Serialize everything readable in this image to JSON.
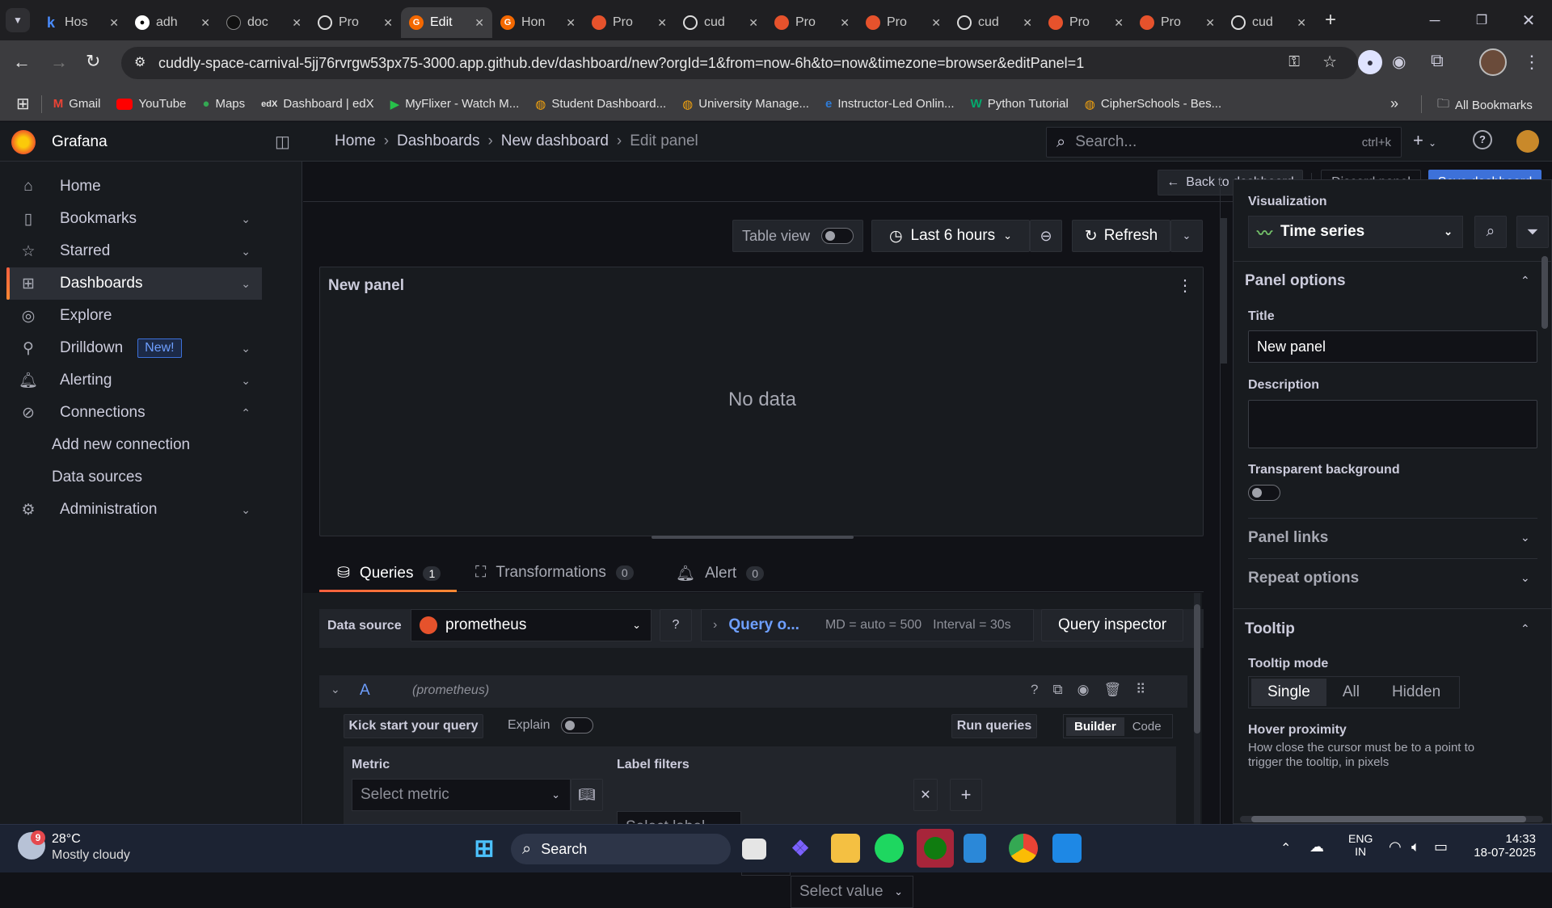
{
  "browser": {
    "tabs": [
      {
        "title": "Hos",
        "icon": "k"
      },
      {
        "title": "adh",
        "icon": "github"
      },
      {
        "title": "doc",
        "icon": "github"
      },
      {
        "title": "Pro",
        "icon": "globe"
      },
      {
        "title": "Edit",
        "icon": "grafana"
      },
      {
        "title": "Hon",
        "icon": "grafana"
      },
      {
        "title": "Pro",
        "icon": "prometheus"
      },
      {
        "title": "cud",
        "icon": "globe"
      },
      {
        "title": "Pro",
        "icon": "prometheus"
      },
      {
        "title": "Pro",
        "icon": "prometheus"
      },
      {
        "title": "cud",
        "icon": "globe"
      },
      {
        "title": "Pro",
        "icon": "prometheus"
      },
      {
        "title": "Pro",
        "icon": "prometheus"
      },
      {
        "title": "cud",
        "icon": "globe"
      }
    ],
    "url": "cuddly-space-carnival-5jj76rvrgw53px75-3000.app.github.dev/dashboard/new?orgId=1&from=now-6h&to=now&timezone=browser&editPanel=1",
    "bookmarks": [
      "Gmail",
      "YouTube",
      "Maps",
      "Dashboard | edX",
      "MyFlixer - Watch M...",
      "Student Dashboard...",
      "University Manage...",
      "Instructor-Led Onlin...",
      "Python Tutorial",
      "CipherSchools - Bes..."
    ],
    "all_bookmarks": "All Bookmarks"
  },
  "grafana": {
    "app_name": "Grafana",
    "breadcrumb": [
      "Home",
      "Dashboards",
      "New dashboard",
      "Edit panel"
    ],
    "search_placeholder": "Search...",
    "search_shortcut": "ctrl+k",
    "nav": [
      {
        "label": "Home",
        "icon": "home-icon"
      },
      {
        "label": "Bookmarks",
        "icon": "bookmark-icon"
      },
      {
        "label": "Starred",
        "icon": "star-icon"
      },
      {
        "label": "Dashboards",
        "icon": "apps-icon"
      },
      {
        "label": "Explore",
        "icon": "compass-icon"
      },
      {
        "label": "Drilldown",
        "icon": "drilldown-icon",
        "badge": "New!"
      },
      {
        "label": "Alerting",
        "icon": "bell-icon"
      },
      {
        "label": "Connections",
        "icon": "connections-icon"
      },
      {
        "label": "Add new connection"
      },
      {
        "label": "Data sources"
      },
      {
        "label": "Administration",
        "icon": "cog-icon"
      }
    ],
    "actions": {
      "back": "Back to dashboard",
      "discard": "Discard panel",
      "save": "Save dashboard"
    },
    "panel_toolbar": {
      "table_view": "Table view",
      "time_range": "Last 6 hours",
      "refresh": "Refresh"
    },
    "panel": {
      "title": "New panel",
      "empty": "No data"
    },
    "tabs": [
      {
        "label": "Queries",
        "count": "1"
      },
      {
        "label": "Transformations",
        "count": "0"
      },
      {
        "label": "Alert",
        "count": "0"
      }
    ],
    "query": {
      "datasource_label": "Data source",
      "datasource": "prometheus",
      "query_options": "Query o...",
      "md": "MD = auto = 500",
      "interval": "Interval = 30s",
      "inspector": "Query inspector",
      "ref_id": "A",
      "ref_ds": "(prometheus)",
      "kick_start": "Kick start your query",
      "explain": "Explain",
      "run": "Run queries",
      "builder": "Builder",
      "code": "Code",
      "metric_label": "Metric",
      "metric_placeholder": "Select metric",
      "label_filters": "Label filters",
      "select_label": "Select label",
      "operator": "=",
      "select_value": "Select value"
    },
    "options": {
      "visualization_label": "Visualization",
      "visualization": "Time series",
      "panel_options": "Panel options",
      "title_label": "Title",
      "title_value": "New panel",
      "description_label": "Description",
      "transparent_label": "Transparent background",
      "panel_links": "Panel links",
      "repeat_options": "Repeat options",
      "tooltip": "Tooltip",
      "tooltip_mode_label": "Tooltip mode",
      "tooltip_modes": [
        "Single",
        "All",
        "Hidden"
      ],
      "hover_label": "Hover proximity",
      "hover_desc": "How close the cursor must be to a point to trigger the tooltip, in pixels"
    }
  },
  "taskbar": {
    "weather_temp": "28°C",
    "weather_desc": "Mostly cloudy",
    "weather_badge": "9",
    "search": "Search",
    "lang1": "ENG",
    "lang2": "IN",
    "time": "14:33",
    "date": "18-07-2025"
  },
  "colors": {
    "accent": "#3d71d9",
    "grafana_orange": "#f05a28",
    "bg": "#111217",
    "panel": "#181b1f"
  }
}
